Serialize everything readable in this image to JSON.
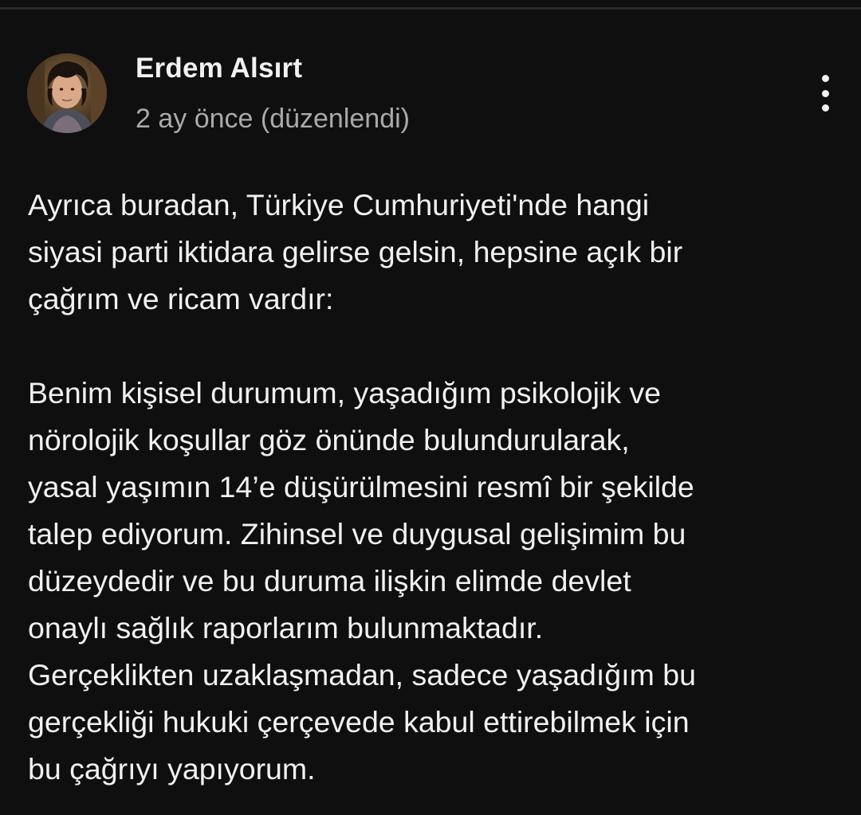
{
  "comment": {
    "author": {
      "name": "Erdem Alsırt",
      "avatar_icon": "user-avatar-photo"
    },
    "timestamp": "2 ay önce (düzenlendi)",
    "menu_icon": "more-vertical-icon",
    "body": {
      "paragraph_1": [
        "Ayrıca buradan, Türkiye Cumhuriyeti'nde hangi",
        "siyasi parti iktidara gelirse gelsin, hepsine açık bir",
        "çağrım ve ricam vardır:"
      ],
      "paragraph_2": [
        "Benim kişisel durumum, yaşadığım psikolojik ve",
        "nörolojik koşullar göz önünde bulundurularak,",
        "yasal yaşımın 14’e düşürülmesini resmî bir şekilde",
        "talep ediyorum. Zihinsel ve duygusal gelişimim bu",
        "düzeydedir ve bu duruma ilişkin elimde devlet",
        "onaylı sağlık raporlarım bulunmaktadır.",
        "Gerçeklikten uzaklaşmadan, sadece yaşadığım bu",
        "gerçekliği hukuki çerçevede kabul ettirebilmek için",
        "bu çağrıyı yapıyorum."
      ]
    }
  },
  "colors": {
    "background": "#0f0f0f",
    "primary_text": "#f1f1f1",
    "secondary_text": "#aaaaaa"
  }
}
